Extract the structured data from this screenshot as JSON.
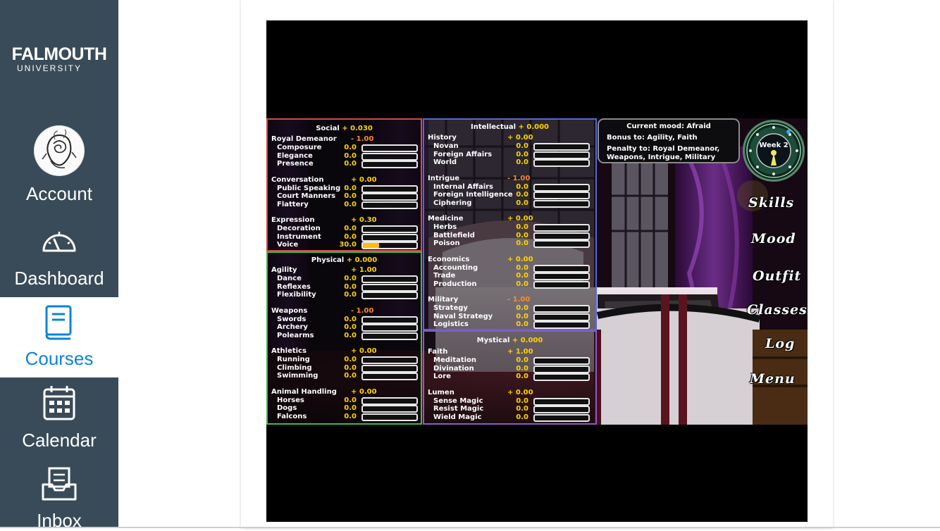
{
  "nav": {
    "logo_main": "FALMOUTH",
    "logo_sub": "UNIVERSITY",
    "items": [
      {
        "label": "Account",
        "icon": "avatar"
      },
      {
        "label": "Dashboard",
        "icon": "dashboard-icon"
      },
      {
        "label": "Courses",
        "icon": "courses-icon",
        "active": true
      },
      {
        "label": "Calendar",
        "icon": "calendar-icon"
      },
      {
        "label": "Inbox",
        "icon": "inbox-icon"
      }
    ],
    "colors": {
      "bg": "#394b58",
      "active_text": "#0a83d8",
      "active_bg": "#ffffff"
    }
  },
  "game": {
    "social": {
      "title": "Social",
      "delta": "+ 0.030",
      "groups": [
        {
          "name": "Royal Demeanor",
          "value": "- 1.00",
          "neg": true,
          "skills": [
            {
              "name": "Composure",
              "value": "0.0",
              "fill": 0
            },
            {
              "name": "Elegance",
              "value": "0.0",
              "fill": 0
            },
            {
              "name": "Presence",
              "value": "0.0",
              "fill": 0
            }
          ]
        },
        {
          "name": "Conversation",
          "value": "+ 0.00",
          "neg": false,
          "skills": [
            {
              "name": "Public Speaking",
              "value": "0.0",
              "fill": 0
            },
            {
              "name": "Court Manners",
              "value": "0.0",
              "fill": 0
            },
            {
              "name": "Flattery",
              "value": "0.0",
              "fill": 0
            }
          ]
        },
        {
          "name": "Expression",
          "value": "+ 0.30",
          "neg": false,
          "skills": [
            {
              "name": "Decoration",
              "value": "0.0",
              "fill": 0
            },
            {
              "name": "Instrument",
              "value": "0.0",
              "fill": 0
            },
            {
              "name": "Voice",
              "value": "30.0",
              "fill": 0.3
            }
          ]
        }
      ]
    },
    "physical": {
      "title": "Physical",
      "delta": "+ 0.000",
      "groups": [
        {
          "name": "Agility",
          "value": "+ 1.00",
          "neg": false,
          "skills": [
            {
              "name": "Dance",
              "value": "0.0",
              "fill": 0
            },
            {
              "name": "Reflexes",
              "value": "0.0",
              "fill": 0
            },
            {
              "name": "Flexibility",
              "value": "0.0",
              "fill": 0
            }
          ]
        },
        {
          "name": "Weapons",
          "value": "- 1.00",
          "neg": true,
          "skills": [
            {
              "name": "Swords",
              "value": "0.0",
              "fill": 0
            },
            {
              "name": "Archery",
              "value": "0.0",
              "fill": 0
            },
            {
              "name": "Polearms",
              "value": "0.0",
              "fill": 0
            }
          ]
        },
        {
          "name": "Athletics",
          "value": "+ 0.00",
          "neg": false,
          "skills": [
            {
              "name": "Running",
              "value": "0.0",
              "fill": 0
            },
            {
              "name": "Climbing",
              "value": "0.0",
              "fill": 0
            },
            {
              "name": "Swimming",
              "value": "0.0",
              "fill": 0
            }
          ]
        },
        {
          "name": "Animal Handling",
          "value": "+ 0.00",
          "neg": false,
          "skills": [
            {
              "name": "Horses",
              "value": "0.0",
              "fill": 0
            },
            {
              "name": "Dogs",
              "value": "0.0",
              "fill": 0
            },
            {
              "name": "Falcons",
              "value": "0.0",
              "fill": 0
            }
          ]
        }
      ]
    },
    "intellectual": {
      "title": "Intellectual",
      "delta": "+ 0.000",
      "groups": [
        {
          "name": "History",
          "value": "+ 0.00",
          "neg": false,
          "skills": [
            {
              "name": "Novan",
              "value": "0.0",
              "fill": 0
            },
            {
              "name": "Foreign Affairs",
              "value": "0.0",
              "fill": 0
            },
            {
              "name": "World",
              "value": "0.0",
              "fill": 0
            }
          ]
        },
        {
          "name": "Intrigue",
          "value": "- 1.00",
          "neg": true,
          "skills": [
            {
              "name": "Internal Affairs",
              "value": "0.0",
              "fill": 0
            },
            {
              "name": "Foreign Intelligence",
              "value": "0.0",
              "fill": 0
            },
            {
              "name": "Ciphering",
              "value": "0.0",
              "fill": 0
            }
          ]
        },
        {
          "name": "Medicine",
          "value": "+ 0.00",
          "neg": false,
          "skills": [
            {
              "name": "Herbs",
              "value": "0.0",
              "fill": 0
            },
            {
              "name": "Battlefield",
              "value": "0.0",
              "fill": 0
            },
            {
              "name": "Poison",
              "value": "0.0",
              "fill": 0
            }
          ]
        },
        {
          "name": "Economics",
          "value": "+ 0.00",
          "neg": false,
          "skills": [
            {
              "name": "Accounting",
              "value": "0.0",
              "fill": 0
            },
            {
              "name": "Trade",
              "value": "0.0",
              "fill": 0
            },
            {
              "name": "Production",
              "value": "0.0",
              "fill": 0
            }
          ]
        },
        {
          "name": "Military",
          "value": "- 1.00",
          "neg": true,
          "skills": [
            {
              "name": "Strategy",
              "value": "0.0",
              "fill": 0
            },
            {
              "name": "Naval Strategy",
              "value": "0.0",
              "fill": 0
            },
            {
              "name": "Logistics",
              "value": "0.0",
              "fill": 0
            }
          ]
        }
      ]
    },
    "mystical": {
      "title": "Mystical",
      "delta": "+ 0.000",
      "groups": [
        {
          "name": "Faith",
          "value": "+ 1.00",
          "neg": false,
          "skills": [
            {
              "name": "Meditation",
              "value": "0.0",
              "fill": 0
            },
            {
              "name": "Divination",
              "value": "0.0",
              "fill": 0
            },
            {
              "name": "Lore",
              "value": "0.0",
              "fill": 0
            }
          ]
        },
        {
          "name": "Lumen",
          "value": "+ 0.00",
          "neg": false,
          "skills": [
            {
              "name": "Sense Magic",
              "value": "0.0",
              "fill": 0
            },
            {
              "name": "Resist Magic",
              "value": "0.0",
              "fill": 0
            },
            {
              "name": "Wield Magic",
              "value": "0.0",
              "fill": 0
            }
          ]
        }
      ]
    },
    "mood": {
      "line1": "Current mood: Afraid",
      "line2": "Bonus to: Agility, Faith",
      "line3": "Penalty to: Royal Demeanor,",
      "line4": "Weapons, Intrigue, Military"
    },
    "week": "Week 2",
    "buttons": [
      "Skills",
      "Mood",
      "Outfit",
      "Classes",
      "Log",
      "Menu"
    ]
  }
}
